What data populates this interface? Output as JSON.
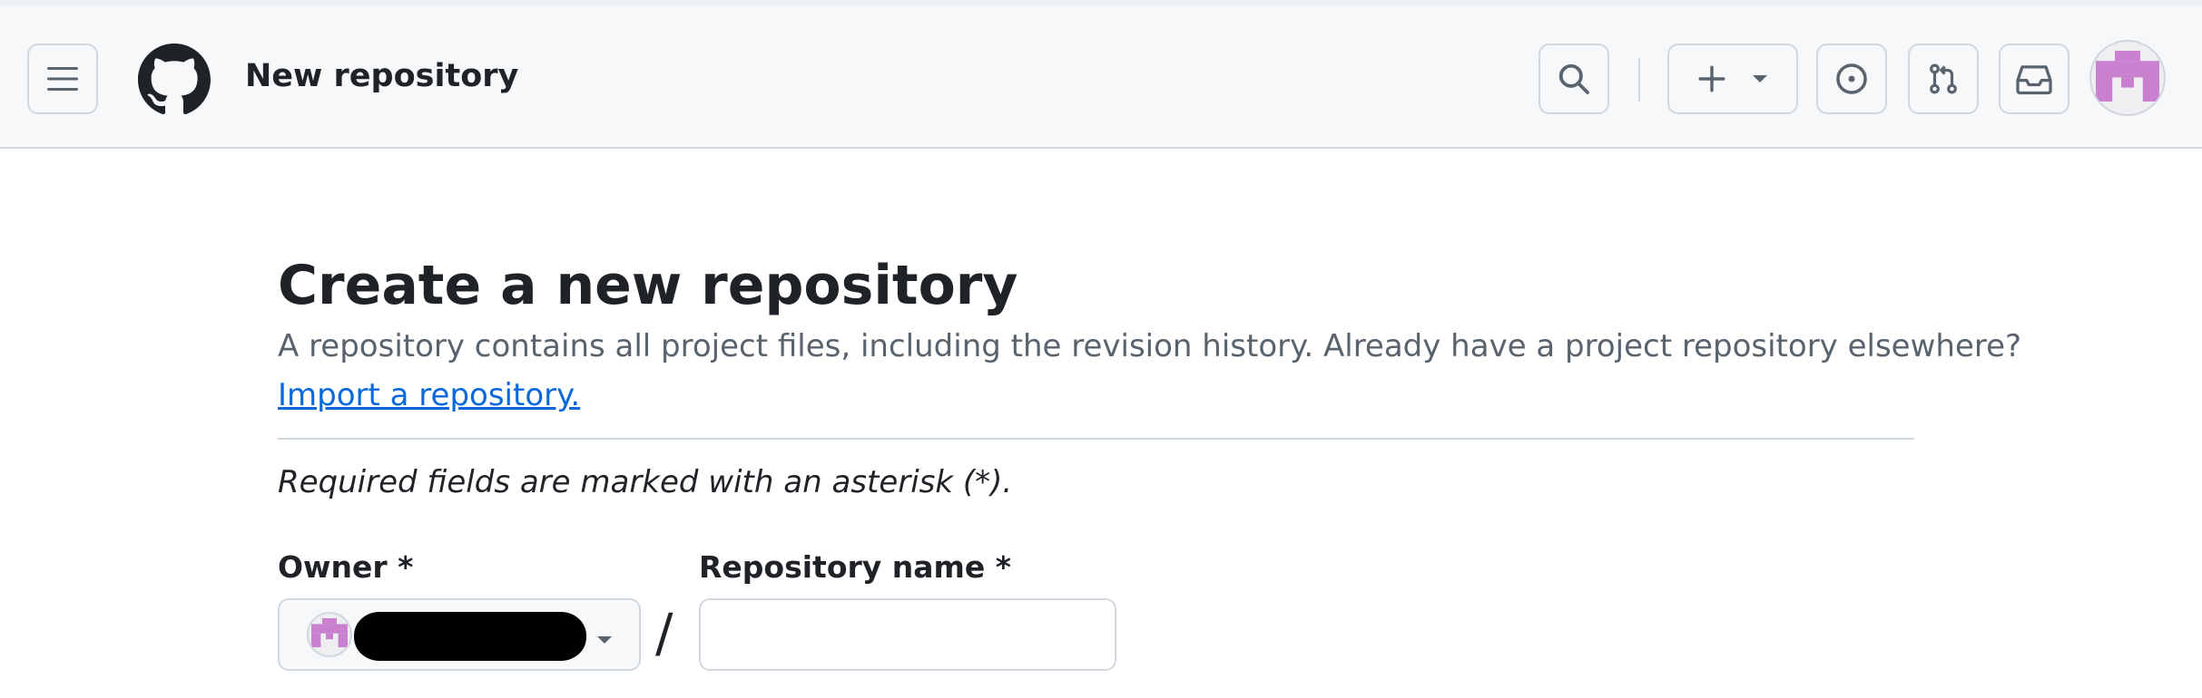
{
  "header": {
    "context_title": "New repository",
    "icons": {
      "menu": "hamburger-menu-icon",
      "logo": "github-mark-icon",
      "search": "search-icon",
      "create": "plus-icon",
      "create_dropdown": "triangle-down-icon",
      "issues": "issue-opened-icon",
      "pulls": "git-pull-request-icon",
      "inbox": "inbox-icon",
      "avatar": "user-identicon"
    }
  },
  "page": {
    "title": "Create a new repository",
    "description": "A repository contains all project files, including the revision history. Already have a project repository elsewhere?",
    "import_link": "Import a repository.",
    "required_note": "Required fields are marked with an asterisk (*)."
  },
  "form": {
    "owner_label": "Owner *",
    "owner_value_redacted": true,
    "separator": "/",
    "repo_name_label": "Repository name *",
    "repo_name_value": ""
  },
  "colors": {
    "header_bg": "#f6f8fa",
    "border": "#d0d7de",
    "link": "#0969da",
    "muted_text": "#59636e",
    "identicon": "#c980ce"
  }
}
